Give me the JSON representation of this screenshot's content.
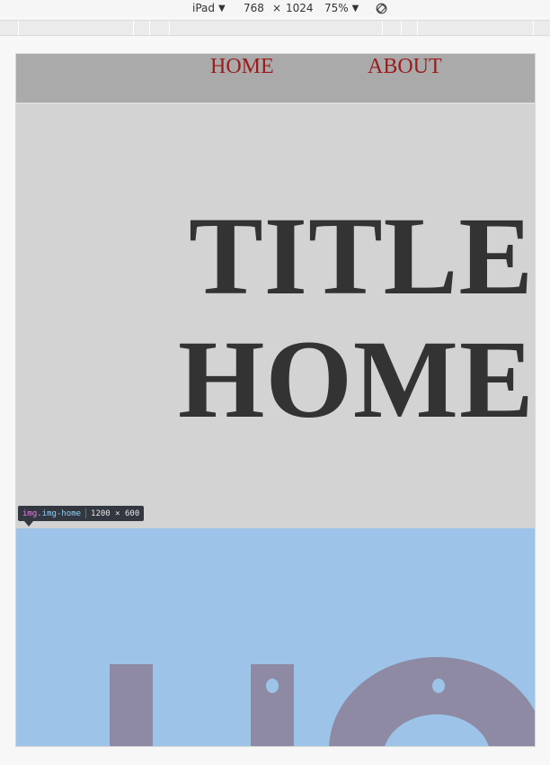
{
  "device_toolbar": {
    "device_name": "iPad",
    "width": "768",
    "times": "×",
    "height": "1024",
    "zoom": "75%",
    "caret_icon": "▼",
    "rotate_icon": "rotate-icon"
  },
  "nav": {
    "items": [
      {
        "label": "HOME"
      },
      {
        "label": "ABOUT"
      }
    ]
  },
  "hero": {
    "title_line1": "TITLE",
    "title_line2": "HOME"
  },
  "inspector_tooltip": {
    "tag": "img",
    "classname": ".img-home",
    "dimensions": "1200 × 600"
  },
  "colors": {
    "nav_bg": "#aaaaaa",
    "nav_link": "#9b1c1c",
    "hero_bg": "#d3d3d3",
    "title_text": "#333333",
    "image_bg": "#9dc4e8",
    "image_letters": "#8e8aa4"
  }
}
